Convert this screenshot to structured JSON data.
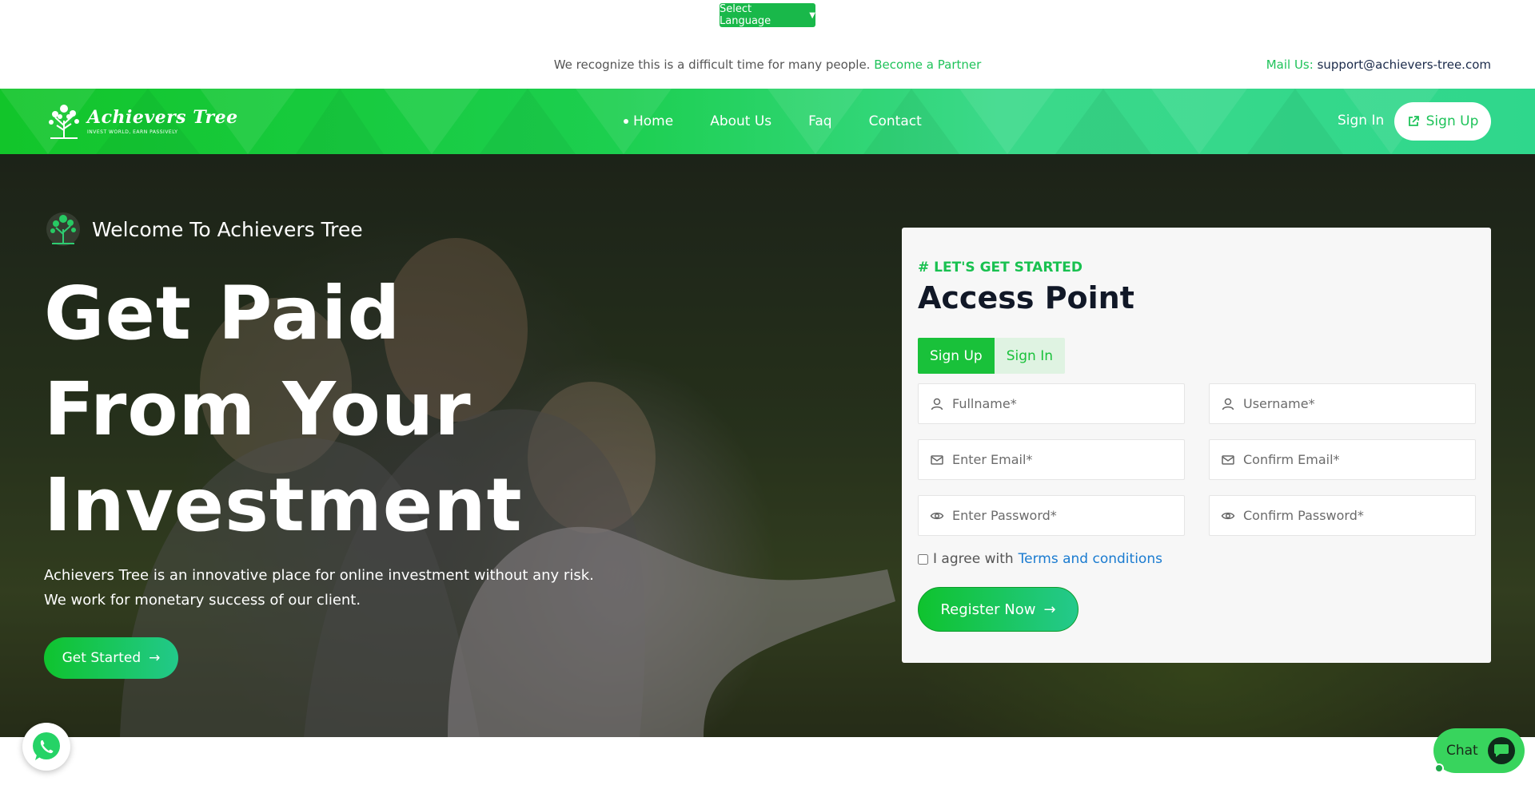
{
  "top_bar": {
    "language_select": "Select Language",
    "notice_text": "We recognize this is a difficult time for many people.",
    "partner_link": "Become a Partner",
    "mail_label": "Mail Us:",
    "mail_address": "support@achievers-tree.com"
  },
  "navbar": {
    "brand": "Achievers Tree",
    "brand_tagline": "INVEST WORLD, EARN PASSIVELY",
    "links": [
      {
        "label": "Home",
        "active": true
      },
      {
        "label": "About Us"
      },
      {
        "label": "Faq"
      },
      {
        "label": "Contact"
      }
    ],
    "sign_in": "Sign In",
    "sign_up": "Sign Up"
  },
  "hero": {
    "welcome": "Welcome To Achievers Tree",
    "headline_line1": "Get Paid",
    "headline_line2": "From Your",
    "headline_line3": "Investment",
    "lead": "Achievers Tree is an innovative place for online investment without any risk. We work for monetary success of our client.",
    "cta": "Get Started"
  },
  "form": {
    "eyebrow": "# LET'S GET STARTED",
    "title": "Access Point",
    "tab_signup": "Sign Up",
    "tab_signin": "Sign In",
    "fullname_placeholder": "Fullname*",
    "username_placeholder": "Username*",
    "email_placeholder": "Enter Email*",
    "confirm_email_placeholder": "Confirm Email*",
    "password_placeholder": "Enter Password*",
    "confirm_password_placeholder": "Confirm Password*",
    "agree_text": "I agree with",
    "terms_link": "Terms and conditions",
    "register": "Register Now"
  },
  "widgets": {
    "chat_label": "Chat"
  },
  "colors": {
    "accent_green": "#1fc35a",
    "tab_green": "#19c13a",
    "link_blue": "#1a7bd0"
  }
}
